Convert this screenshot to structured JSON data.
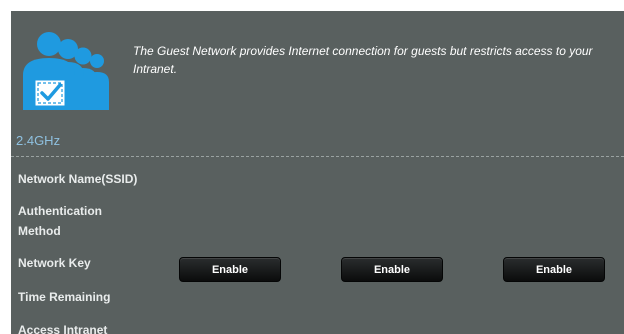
{
  "intro_text": "The Guest Network provides Internet connection for guests but restricts access to your Intranet.",
  "band_label": "2.4GHz",
  "labels": {
    "network_name": "Network Name(SSID)",
    "authentication_method": "Authentication Method",
    "network_key": "Network Key",
    "time_remaining": "Time Remaining",
    "access_intranet": "Access Intranet"
  },
  "buttons": [
    "Enable",
    "Enable",
    "Enable"
  ],
  "colors": {
    "panel_bg": "#59605f",
    "band_accent": "#8fc1e0",
    "icon_blue": "#1f9ae0",
    "button_bg": "#1a1c1d"
  },
  "icons": {
    "guest": "guest-users-check-icon"
  }
}
